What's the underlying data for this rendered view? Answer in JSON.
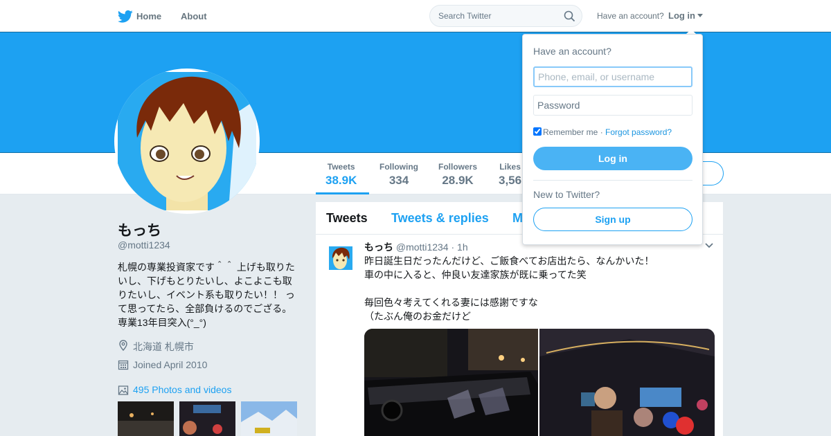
{
  "nav": {
    "home_label": "Home",
    "about_label": "About",
    "search_placeholder": "Search Twitter",
    "have_account": "Have an account?",
    "login_label": "Log in",
    "brand_icon": "twitter-bird-icon"
  },
  "colors": {
    "brand": "#1da1f2",
    "banner": "#1da1f2",
    "background": "#e6ecf0",
    "login_button": "#4ab3f4"
  },
  "stats": [
    {
      "label": "Tweets",
      "value": "38.9K"
    },
    {
      "label": "Following",
      "value": "334"
    },
    {
      "label": "Followers",
      "value": "28.9K"
    },
    {
      "label": "Likes",
      "value": "3,56"
    }
  ],
  "profile": {
    "name": "もっち",
    "handle": "@motti1234",
    "bio": "札幌の専業投資家です＾＾ 上げも取りた\nいし、下げもとりたいし、よこよこも取\nりたいし、イベント系も取りたい！！ っ\nて思ってたら、全部負けるのでござる。\n専業13年目突入(°_°)",
    "location": "北海道 札幌市",
    "joined": "Joined April 2010",
    "photos_videos": "495 Photos and videos"
  },
  "timeline": {
    "tabs": [
      "Tweets",
      "Tweets & replies",
      "M"
    ],
    "tweet": {
      "name": "もっち",
      "handle": "@motti1234",
      "time": "· 1h",
      "text": "昨日誕生日だったんだけど、ご飯食べてお店出たら、なんかいた！\n車の中に入ると、仲良い友達家族が既に乗ってた笑\n\n毎回色々考えてくれる妻には感謝ですな\n（たぶん俺のお金だけど"
    }
  },
  "login_dropdown": {
    "heading": "Have an account?",
    "username_placeholder": "Phone, email, or username",
    "password_placeholder": "Password",
    "remember_me": "Remember me",
    "separator": " · ",
    "forgot_password": "Forgot password?",
    "login_button": "Log in",
    "new_to_twitter": "New to Twitter?",
    "signup_button": "Sign up"
  }
}
